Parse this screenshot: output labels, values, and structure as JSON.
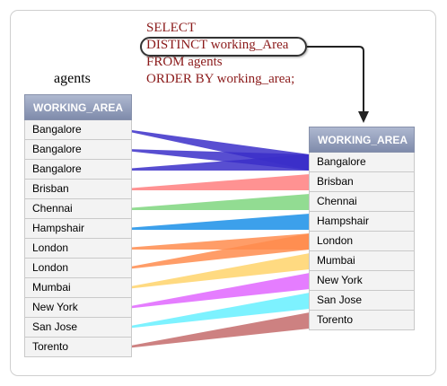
{
  "query": {
    "lines": [
      "SELECT",
      "DISTINCT working_Area",
      "FROM agents",
      "ORDER BY working_area;"
    ]
  },
  "left_table": {
    "caption": "agents",
    "header": "WORKING_AREA",
    "rows": [
      "Bangalore",
      "Bangalore",
      "Bangalore",
      "Brisban",
      "Chennai",
      "Hampshair",
      "London",
      "London",
      "Mumbai",
      "New York",
      "San Jose",
      "Torento"
    ]
  },
  "right_table": {
    "header": "WORKING_AREA",
    "rows": [
      "Bangalore",
      "Brisban",
      "Chennai",
      "Hampshair",
      "London",
      "Mumbai",
      "New York",
      "San Jose",
      "Torento"
    ]
  },
  "mappings": [
    {
      "from": 0,
      "to": 0,
      "color": "#3b2fc9"
    },
    {
      "from": 1,
      "to": 0,
      "color": "#3b2fc9"
    },
    {
      "from": 2,
      "to": 0,
      "color": "#3b2fc9"
    },
    {
      "from": 3,
      "to": 1,
      "color": "#ff7f7f"
    },
    {
      "from": 4,
      "to": 2,
      "color": "#7fd67f"
    },
    {
      "from": 5,
      "to": 3,
      "color": "#1a8fe8"
    },
    {
      "from": 6,
      "to": 4,
      "color": "#ff8c4d"
    },
    {
      "from": 7,
      "to": 4,
      "color": "#ff8c4d"
    },
    {
      "from": 8,
      "to": 5,
      "color": "#ffd36b"
    },
    {
      "from": 9,
      "to": 6,
      "color": "#e066ff"
    },
    {
      "from": 10,
      "to": 7,
      "color": "#66f0ff"
    },
    {
      "from": 11,
      "to": 8,
      "color": "#c46b6b"
    }
  ]
}
